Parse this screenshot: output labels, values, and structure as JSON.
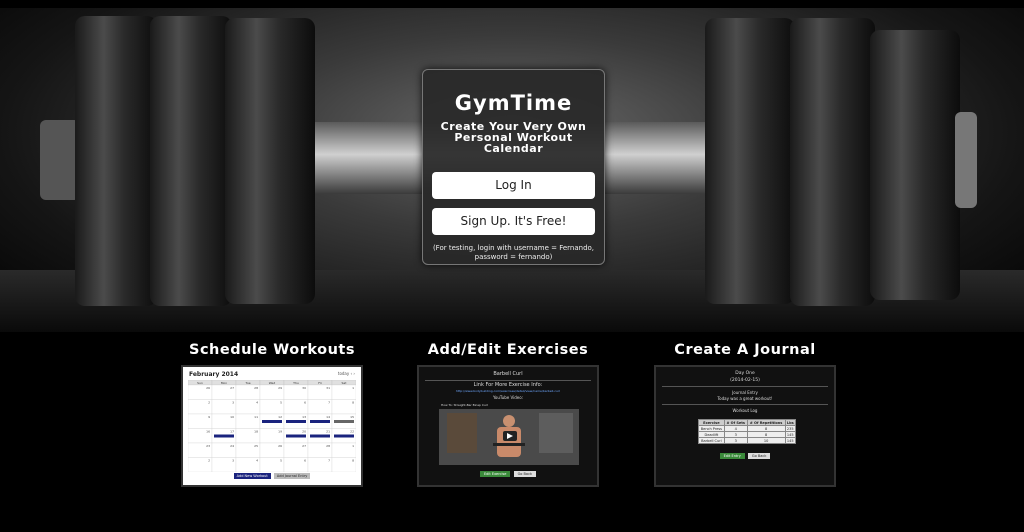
{
  "hero": {
    "brand": "GymTime",
    "tagline": "Create Your Very Own Personal Workout Calendar",
    "login_label": "Log In",
    "signup_label": "Sign Up. It's Free!",
    "test_hint": "(For testing, login with username = Fernando, password = fernando)"
  },
  "features": [
    {
      "title": "Schedule Workouts"
    },
    {
      "title": "Add/Edit Exercises"
    },
    {
      "title": "Create A Journal"
    }
  ],
  "calendar_preview": {
    "month": "February 2014",
    "nav": "today  ‹  ›",
    "days": [
      "Sun",
      "Mon",
      "Tue",
      "Wed",
      "Thu",
      "Fri",
      "Sat"
    ],
    "dates": [
      [
        "26",
        "27",
        "28",
        "29",
        "30",
        "31",
        "1"
      ],
      [
        "2",
        "3",
        "4",
        "5",
        "6",
        "7",
        "8"
      ],
      [
        "9",
        "10",
        "11",
        "12",
        "13",
        "14",
        "15"
      ],
      [
        "16",
        "17",
        "18",
        "19",
        "20",
        "21",
        "22"
      ],
      [
        "23",
        "24",
        "25",
        "26",
        "27",
        "28",
        "1"
      ],
      [
        "2",
        "3",
        "4",
        "5",
        "6",
        "7",
        "8"
      ]
    ],
    "buttons": [
      "Add New Workout",
      "Add Journal Entry"
    ]
  },
  "exercise_preview": {
    "title": "Barbell Curl",
    "info_label": "Link For More Exercise Info:",
    "info_link": "http://www.bodybuilding.com/exercises/detail/view/name/barbell-curl",
    "video_label": "YouTube Video:",
    "video_caption": "How To: Straight-Bar Bicep Curl",
    "buttons": [
      "Edit Exercise",
      "Go Back"
    ]
  },
  "journal_preview": {
    "title": "Day One",
    "date": "(2014-02-15)",
    "entry_label": "Journal Entry",
    "entry_text": "Today was a great workout!",
    "log_label": "Workout Log",
    "columns": [
      "Exercise",
      "# Of Sets",
      "# Of Repetitions",
      "Lbs"
    ],
    "rows": [
      [
        "Bench Press",
        "4",
        "8",
        "235"
      ],
      [
        "Deadlift",
        "3",
        "8",
        "145"
      ],
      [
        "Barbell Curl",
        "3",
        "10",
        "145"
      ]
    ],
    "buttons": [
      "Edit Entry",
      "Go Back"
    ]
  },
  "colors": {
    "card_bg": "#282828",
    "calendar_event": "#1a237e",
    "action_green": "#3a8a3a"
  }
}
